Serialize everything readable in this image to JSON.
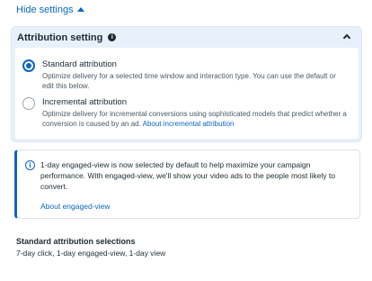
{
  "toggle": {
    "hide_settings_label": "Hide settings"
  },
  "attribution": {
    "title": "Attribution setting",
    "options": [
      {
        "label": "Standard attribution",
        "description": "Optimize delivery for a selected time window and interaction type. You can use the default or edit this below.",
        "selected": true
      },
      {
        "label": "Incremental attribution",
        "description": "Optimize delivery for incremental conversions using sophisticated models that predict whether a conversion is caused by an ad.",
        "link": "About incremental attribution",
        "selected": false
      }
    ]
  },
  "notice": {
    "text": "1-day engaged-view is now selected by default to help maximize your campaign performance. With engaged-view, we'll show your video ads to the people most likely to convert.",
    "link": "About engaged-view"
  },
  "standard_selections": {
    "title": "Standard attribution selections",
    "value": "7-day click, 1-day engaged-view, 1-day view"
  },
  "colors": {
    "accent": "#0a66c2",
    "panel_bg": "#e8f1fb",
    "text": "#1c2b33"
  },
  "icons": {
    "toggle": "caret-up-icon",
    "info": "info-icon",
    "collapse": "chevron-up-icon",
    "notice": "info-circle-icon"
  }
}
